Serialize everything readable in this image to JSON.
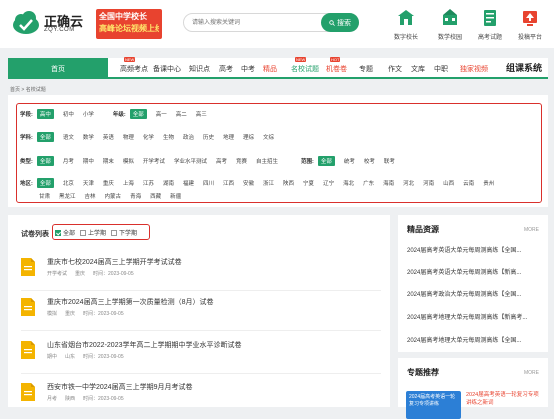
{
  "header": {
    "logo_name": "正确云",
    "logo_domain": "ZQY.COM",
    "banner_line1": "全国中学校长",
    "banner_line2": "高峰论坛视频上线",
    "search_placeholder": "请输入搜索关键词",
    "search_button": "搜索",
    "top_icons": [
      {
        "label": "数字校长",
        "icon": "principal-icon"
      },
      {
        "label": "数学校园",
        "icon": "campus-icon"
      },
      {
        "label": "高考试题",
        "icon": "exam-icon"
      },
      {
        "label": "投稿平台",
        "icon": "upload-icon"
      }
    ]
  },
  "nav": {
    "home": "首页",
    "items": [
      "高频考点",
      "备课中心",
      "知识点",
      "高考",
      "中考",
      "精品",
      "名校试题",
      "机卷卷",
      "专题",
      "作文",
      "文库",
      "中职",
      "独家视频"
    ],
    "new_badge": "NEW",
    "hot_badge": "HOT",
    "brand": "组课系统"
  },
  "breadcrumb": "首页  >  名校试题",
  "filters": {
    "stage": {
      "label": "学段:",
      "options": [
        "高中",
        "初中",
        "小学"
      ],
      "selected": 0
    },
    "grade": {
      "label": "年级:",
      "options": [
        "全部",
        "高一",
        "高二",
        "高三"
      ],
      "selected": 0
    },
    "subject": {
      "label": "学科:",
      "options": [
        "全部",
        "语文",
        "数学",
        "英语",
        "物理",
        "化学",
        "生物",
        "政治",
        "历史",
        "地理",
        "理综",
        "文综"
      ],
      "selected": 0
    },
    "type": {
      "label": "类型:",
      "options": [
        "全部",
        "月考",
        "期中",
        "期末",
        "模拟",
        "开学考试",
        "学业水平测试",
        "高考",
        "竞赛",
        "自主招生"
      ],
      "selected": 0
    },
    "range": {
      "label": "范围:",
      "options": [
        "全部",
        "统考",
        "校考",
        "联考"
      ],
      "selected": 0
    },
    "region_label": "地区:",
    "region_row1": [
      "全部",
      "北京",
      "天津",
      "重庆",
      "上海",
      "江苏",
      "湖南",
      "福建",
      "四川",
      "江西",
      "安徽",
      "浙江",
      "陕西",
      "宁夏",
      "辽宁",
      "海北",
      "广东",
      "海南",
      "河北",
      "河南",
      "山西",
      "云南",
      "贵州"
    ],
    "region_row2": [
      "甘肃",
      "黑龙江",
      "吉林",
      "内蒙古",
      "青海",
      "西藏",
      "新疆"
    ]
  },
  "list": {
    "title": "试卷列表",
    "checks": [
      {
        "label": "全部",
        "checked": true
      },
      {
        "label": "上学期",
        "checked": false
      },
      {
        "label": "下学期",
        "checked": false
      }
    ],
    "items": [
      {
        "title": "重庆市七校2024届高三上学期开学考试试卷",
        "type": "开学考试",
        "region": "重庆",
        "time": "时间：2023-09-05"
      },
      {
        "title": "重庆市2024届高三上学期第一次质量检测（8月）试卷",
        "type": "模拟",
        "region": "重庆",
        "time": "时间：2023-09-05"
      },
      {
        "title": "山东省烟台市2022-2023学年高二上学期期中学业水平诊断试卷",
        "type": "期中",
        "region": "山东",
        "time": "时间：2023-09-05"
      },
      {
        "title": "西安市铁一中学2024届高三上学期9月月考试卷",
        "type": "月考",
        "region": "陕西",
        "time": "时间：2023-09-05"
      }
    ]
  },
  "sidebar": {
    "resources_title": "精品资源",
    "more": "MORE",
    "resources": [
      "2024届高考英语大单元每周测高练【全国...",
      "2024届高考英语大单元每周测高练【新高...",
      "2024届高考政治大单元每周测高练【全国...",
      "2024届高考地理大单元每周测高练【新高考...",
      "2024届高考地理大单元每周测高练【全国..."
    ],
    "topics_title": "专题推荐",
    "promo": "2024届高考英语一轮复习专项讲练",
    "promo_caption": "2024届高考英语一轮复习专项讲练之新词"
  },
  "colors": {
    "accent": "#23a06b",
    "red": "#e8432f",
    "highlight": "#d9302c"
  }
}
